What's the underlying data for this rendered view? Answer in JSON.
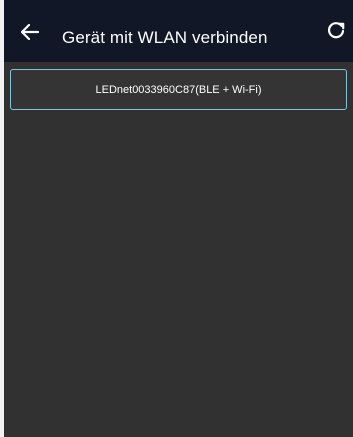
{
  "header": {
    "title": "Gerät mit WLAN verbinden",
    "back_icon": "arrow-left-icon",
    "refresh_icon": "refresh-icon"
  },
  "devices": [
    {
      "name": "LEDnet0033960C87(BLE + Wi-Fi)"
    }
  ],
  "colors": {
    "header_bg": "#111727",
    "content_bg": "#313131",
    "accent": "#7fc7d8"
  }
}
